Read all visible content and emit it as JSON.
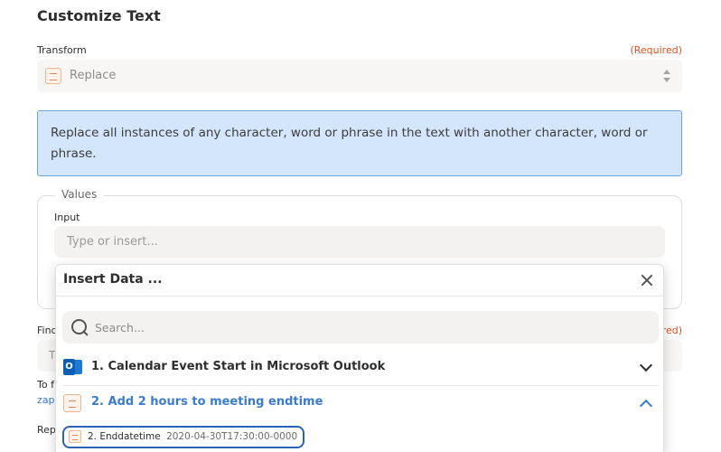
{
  "page": {
    "title": "Customize Text"
  },
  "transform": {
    "label": "Transform",
    "required": "(Required)",
    "value": "Replace"
  },
  "info": {
    "text": "Replace all instances of any character, word or phrase in the text with another character, word or phrase."
  },
  "values": {
    "legend": "Values",
    "input_label": "Input",
    "input_placeholder": "Type or insert..."
  },
  "background": {
    "find_label": "Find",
    "find_required": "red)",
    "find_placeholder": "T",
    "help_text": "To f",
    "help_link": "zaps",
    "replace_label": "Rep"
  },
  "insert_data": {
    "title": "Insert Data ...",
    "search_placeholder": "Search...",
    "steps": [
      {
        "label": "1. Calendar Event Start in Microsoft Outlook",
        "icon": "outlook-icon",
        "expanded": false
      },
      {
        "label": "2. Add 2 hours to meeting endtime",
        "icon": "formatter-icon",
        "expanded": true
      }
    ],
    "field": {
      "key": "2. Enddatetime",
      "value": "2020-04-30T17:30:00-0000"
    }
  },
  "colors": {
    "accent": "#3b7bd0",
    "required": "#d4551e",
    "info_bg": "#d4e6fb",
    "chip_border": "#2a62b8"
  }
}
